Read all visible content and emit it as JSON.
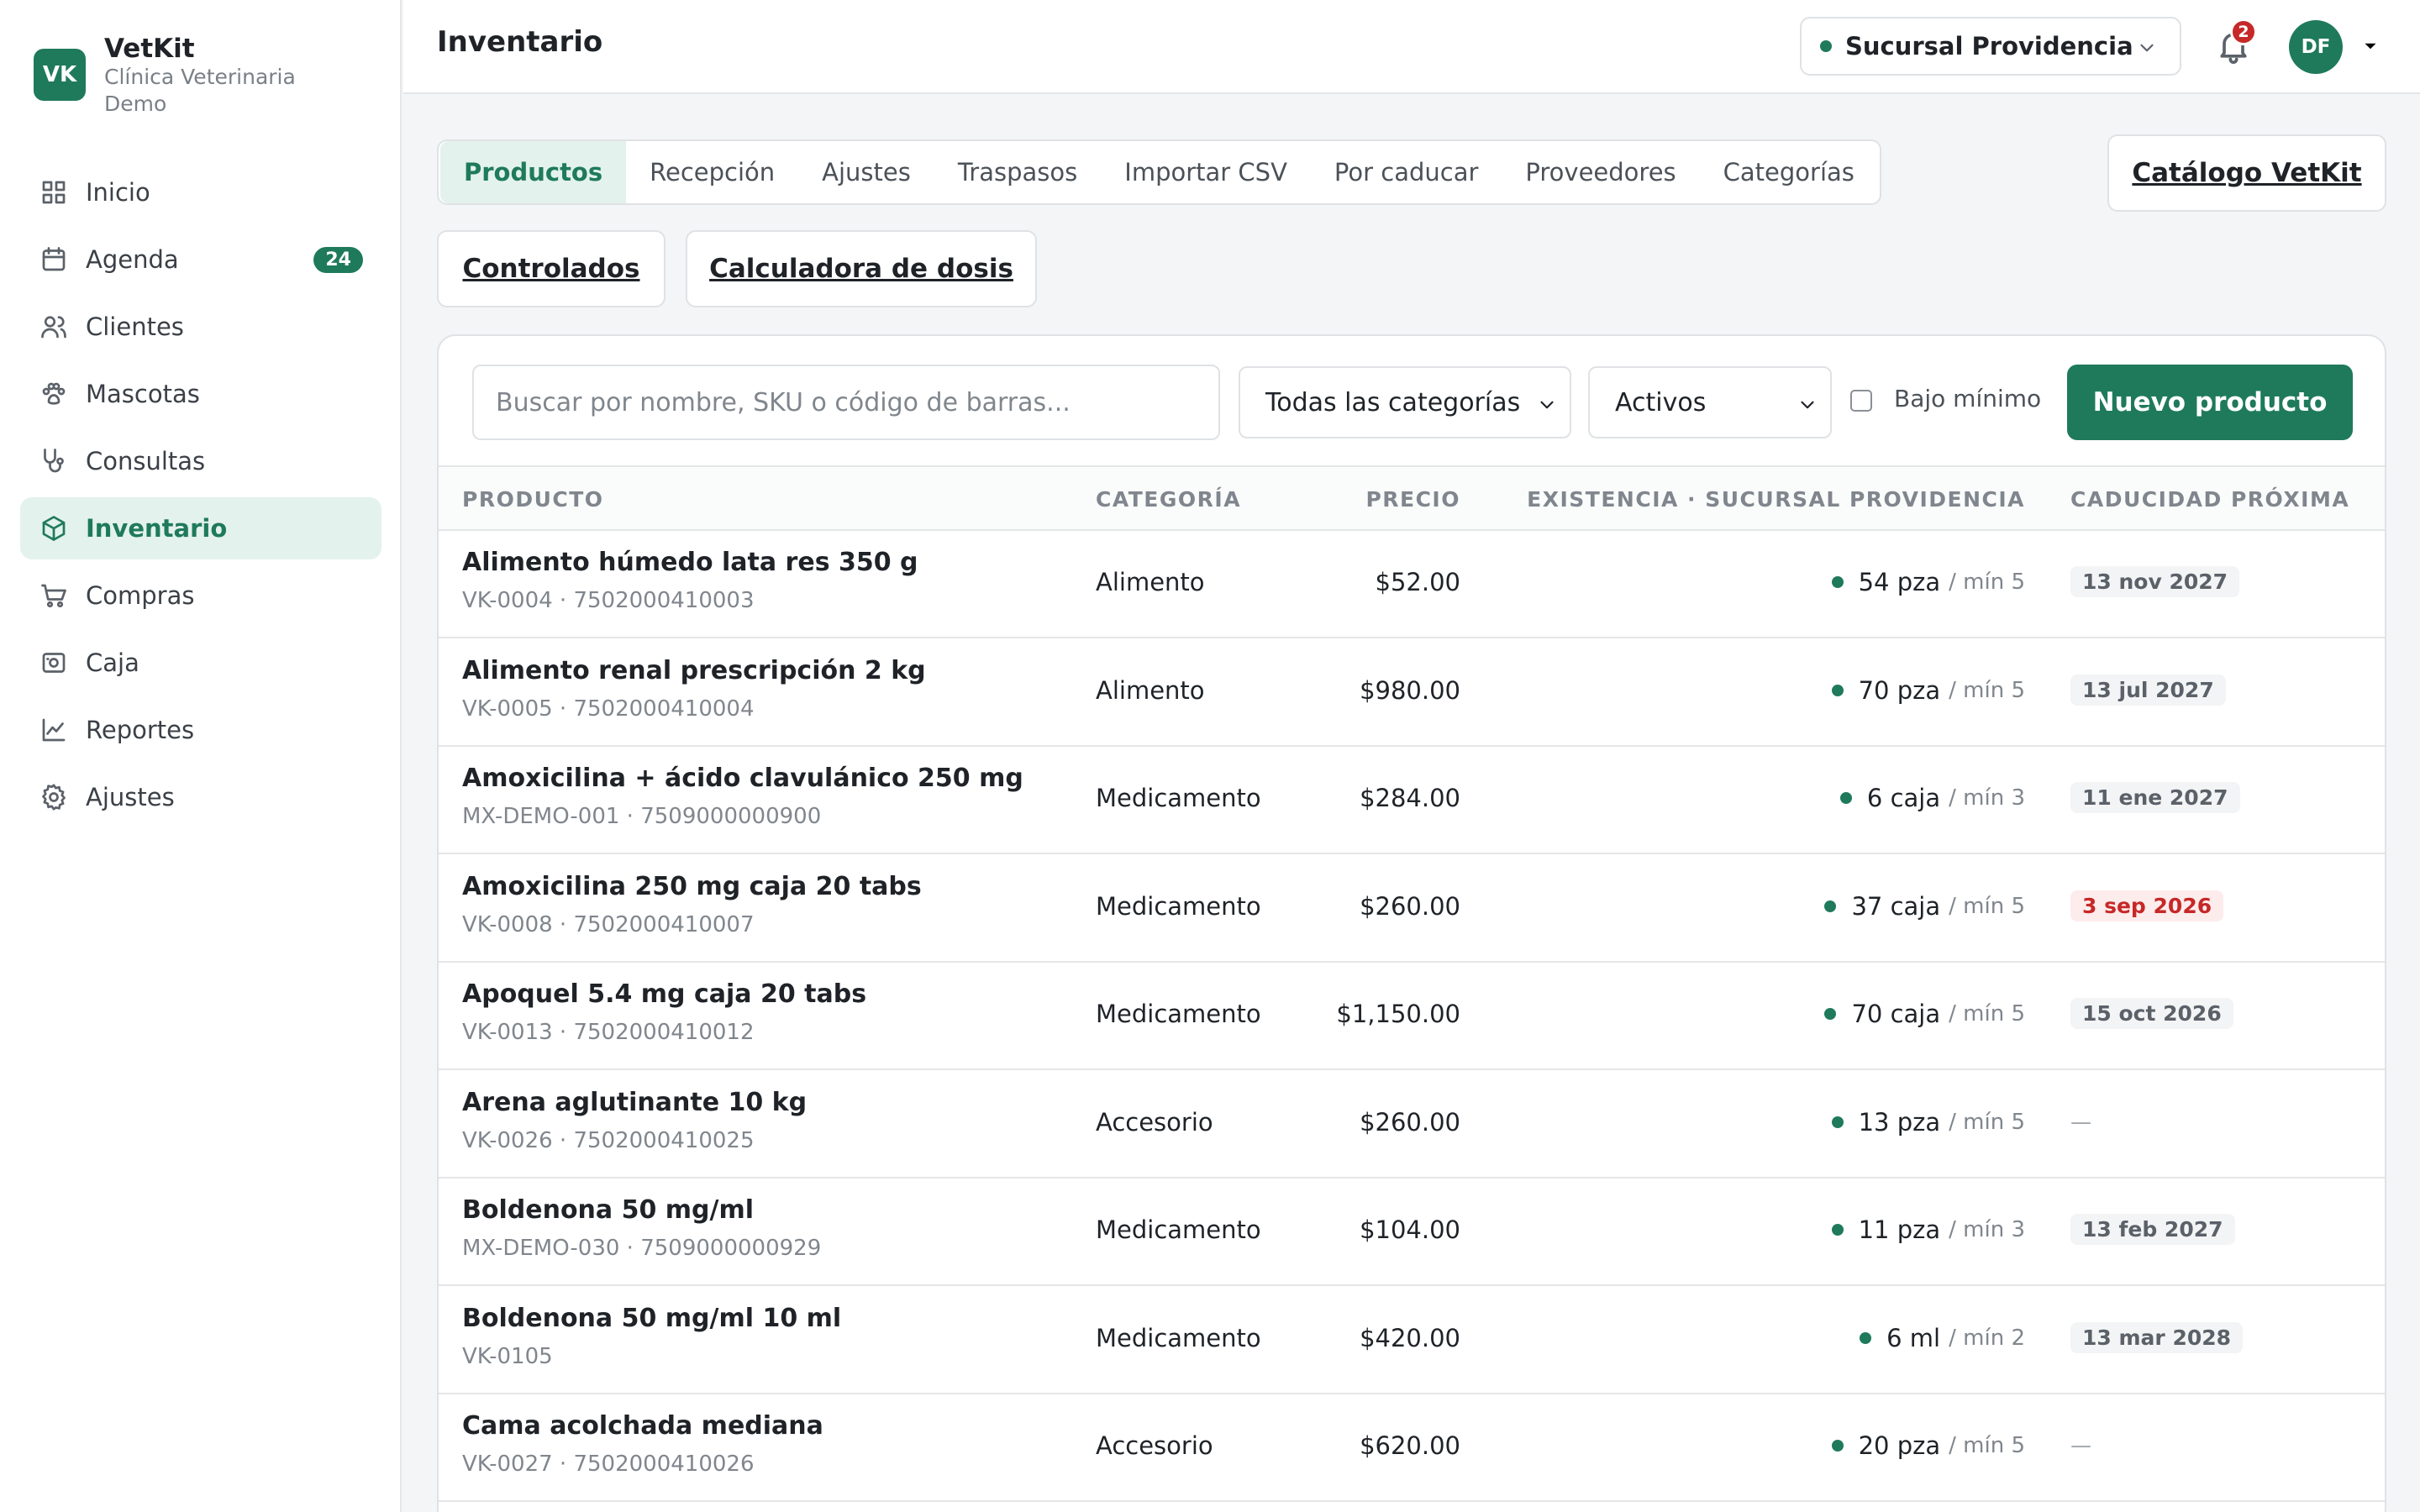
{
  "brand": {
    "logo": "VK",
    "name": "VetKit",
    "subtitle": "Clínica Veterinaria Demo"
  },
  "sidebar": {
    "items": [
      {
        "label": "Inicio",
        "icon": "grid-icon"
      },
      {
        "label": "Agenda",
        "icon": "calendar-icon",
        "badge": "24"
      },
      {
        "label": "Clientes",
        "icon": "users-icon"
      },
      {
        "label": "Mascotas",
        "icon": "paw-icon"
      },
      {
        "label": "Consultas",
        "icon": "stethoscope-icon"
      },
      {
        "label": "Inventario",
        "icon": "box-icon",
        "active": true
      },
      {
        "label": "Compras",
        "icon": "cart-icon"
      },
      {
        "label": "Caja",
        "icon": "cash-icon"
      },
      {
        "label": "Reportes",
        "icon": "chart-icon"
      },
      {
        "label": "Ajustes",
        "icon": "gear-icon"
      }
    ]
  },
  "header": {
    "title": "Inventario",
    "branch": "Sucursal Providencia",
    "notifications": "2",
    "avatar": "DF"
  },
  "tabs": [
    "Productos",
    "Recepción",
    "Ajustes",
    "Traspasos",
    "Importar CSV",
    "Por caducar",
    "Proveedores",
    "Categorías"
  ],
  "links": {
    "catalog": "Catálogo VetKit",
    "controlled": "Controlados",
    "dose_calc": "Calculadora de dosis"
  },
  "filters": {
    "search_placeholder": "Buscar por nombre, SKU o código de barras...",
    "category": "Todas las categorías",
    "status": "Activos",
    "below_min": "Bajo mínimo",
    "new_product": "Nuevo producto"
  },
  "table": {
    "headers": {
      "product": "PRODUCTO",
      "category": "CATEGORÍA",
      "price": "PRECIO",
      "stock": "EXISTENCIA · SUCURSAL PROVIDENCIA",
      "expiry": "CADUCIDAD PRÓXIMA"
    },
    "rows": [
      {
        "name": "Alimento húmedo lata res 350 g",
        "sku": "VK-0004 · 7502000410003",
        "category": "Alimento",
        "price": "$52.00",
        "stock": "54 pza",
        "min": "/ mín 5",
        "expiry": "13 nov 2027",
        "expiry_status": "normal"
      },
      {
        "name": "Alimento renal prescripción 2 kg",
        "sku": "VK-0005 · 7502000410004",
        "category": "Alimento",
        "price": "$980.00",
        "stock": "70 pza",
        "min": "/ mín 5",
        "expiry": "13 jul 2027",
        "expiry_status": "normal"
      },
      {
        "name": "Amoxicilina + ácido clavulánico 250 mg",
        "sku": "MX-DEMO-001 · 7509000000900",
        "category": "Medicamento",
        "price": "$284.00",
        "stock": "6 caja",
        "min": "/ mín 3",
        "expiry": "11 ene 2027",
        "expiry_status": "normal"
      },
      {
        "name": "Amoxicilina 250 mg caja 20 tabs",
        "sku": "VK-0008 · 7502000410007",
        "category": "Medicamento",
        "price": "$260.00",
        "stock": "37 caja",
        "min": "/ mín 5",
        "expiry": "3 sep 2026",
        "expiry_status": "warn"
      },
      {
        "name": "Apoquel 5.4 mg caja 20 tabs",
        "sku": "VK-0013 · 7502000410012",
        "category": "Medicamento",
        "price": "$1,150.00",
        "stock": "70 caja",
        "min": "/ mín 5",
        "expiry": "15 oct 2026",
        "expiry_status": "normal"
      },
      {
        "name": "Arena aglutinante 10 kg",
        "sku": "VK-0026 · 7502000410025",
        "category": "Accesorio",
        "price": "$260.00",
        "stock": "13 pza",
        "min": "/ mín 5",
        "expiry": "—",
        "expiry_status": "none"
      },
      {
        "name": "Boldenona 50 mg/ml",
        "sku": "MX-DEMO-030 · 7509000000929",
        "category": "Medicamento",
        "price": "$104.00",
        "stock": "11 pza",
        "min": "/ mín 3",
        "expiry": "13 feb 2027",
        "expiry_status": "normal"
      },
      {
        "name": "Boldenona 50 mg/ml 10 ml",
        "sku": "VK-0105",
        "category": "Medicamento",
        "price": "$420.00",
        "stock": "6 ml",
        "min": "/ mín 2",
        "expiry": "13 mar 2028",
        "expiry_status": "normal"
      },
      {
        "name": "Cama acolchada mediana",
        "sku": "VK-0027 · 7502000410026",
        "category": "Accesorio",
        "price": "$620.00",
        "stock": "20 pza",
        "min": "/ mín 5",
        "expiry": "—",
        "expiry_status": "none"
      }
    ]
  },
  "colors": {
    "accent": "#1f7a5c",
    "danger": "#c62828",
    "active_bg": "#e3f2ec"
  }
}
